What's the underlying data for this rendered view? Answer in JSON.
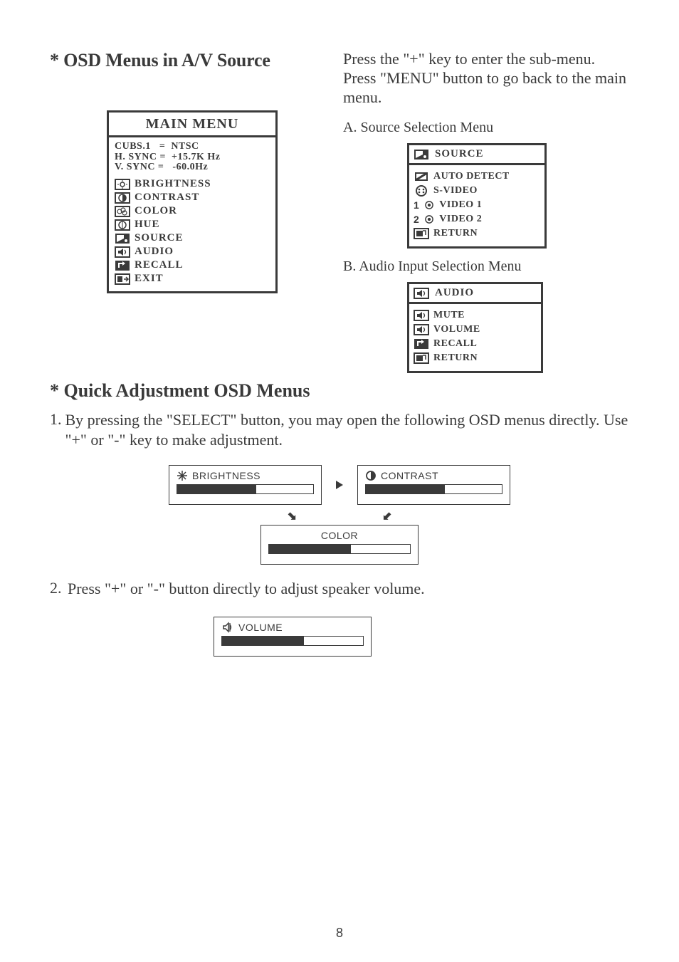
{
  "left": {
    "title": "* OSD Menus in A/V Source"
  },
  "right": {
    "para": "Press the \"+\" key to enter the sub-menu. Press \"MENU\" button to go back to the main menu.",
    "a_label": "A. Source Selection Menu",
    "b_label": "B. Audio Input Selection Menu"
  },
  "main_menu": {
    "title": "MAIN MENU",
    "sync": "CUBS.1   =  NTSC\nH. SYNC =  +15.7K Hz\nV. SYNC =   -60.0Hz",
    "items": [
      {
        "label": "BRIGHTNESS",
        "icon": "brightness-icon"
      },
      {
        "label": "CONTRAST",
        "icon": "contrast-icon"
      },
      {
        "label": "COLOR",
        "icon": "color-icon"
      },
      {
        "label": "HUE",
        "icon": "hue-icon"
      },
      {
        "label": "SOURCE",
        "icon": "source-icon"
      },
      {
        "label": "AUDIO",
        "icon": "audio-icon"
      },
      {
        "label": "RECALL",
        "icon": "recall-icon"
      },
      {
        "label": "EXIT",
        "icon": "exit-icon"
      }
    ]
  },
  "source_menu": {
    "title": "SOURCE",
    "items": [
      {
        "label": "AUTO DETECT",
        "icon": "autodetect-icon"
      },
      {
        "label": "S-VIDEO",
        "icon": "svideo-icon"
      },
      {
        "label": "VIDEO 1",
        "icon": "video1-icon",
        "prefix": "1"
      },
      {
        "label": "VIDEO 2",
        "icon": "video2-icon",
        "prefix": "2"
      },
      {
        "label": "RETURN",
        "icon": "return-icon"
      }
    ]
  },
  "audio_menu": {
    "title": "AUDIO",
    "items": [
      {
        "label": "MUTE",
        "icon": "mute-icon"
      },
      {
        "label": "VOLUME",
        "icon": "volume-icon"
      },
      {
        "label": "RECALL",
        "icon": "recall-icon"
      },
      {
        "label": "RETURN",
        "icon": "return-icon"
      }
    ]
  },
  "quick": {
    "title": "* Quick Adjustment OSD Menus",
    "step1": "By pressing the \"SELECT\" button, you may open the following OSD menus directly. Use \"+\" or \"-\" key to make adjustment.",
    "step1_num": "1.",
    "step2_num": "2.",
    "step2": "Press \"+\" or \"-\" button directly to adjust speaker volume.",
    "boxes": {
      "brightness": {
        "label": "BRIGHTNESS",
        "fill": 58
      },
      "contrast": {
        "label": "CONTRAST",
        "fill": 58
      },
      "color": {
        "label": "COLOR",
        "fill": 58
      },
      "volume": {
        "label": "VOLUME",
        "fill": 58
      }
    }
  },
  "page_number": "8"
}
